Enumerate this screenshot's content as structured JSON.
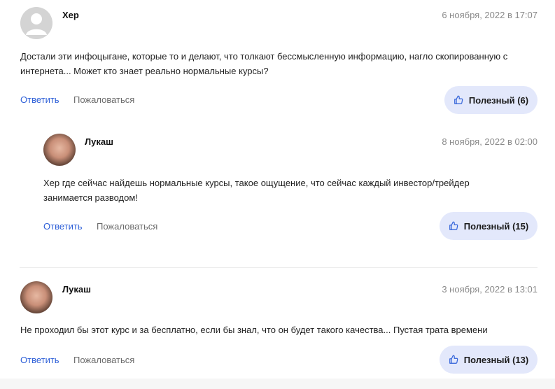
{
  "comments": [
    {
      "author": "Хер",
      "date": "6 ноября, 2022 в 17:07",
      "text": "Достали эти инфоцыгане, которые то и делают, что толкают бессмысленную информацию, нагло скопированную с интернета... Может кто знает реально нормальные курсы?",
      "reply_label": "Ответить",
      "report_label": "Пожаловаться",
      "useful_label": "Полезный (6)"
    },
    {
      "author": "Лукаш",
      "date": "8 ноября, 2022 в 02:00",
      "text": "Хер где сейчас найдешь нормальные курсы, такое ощущение, что сейчас каждый инвестор/трейдер занимается разводом!",
      "reply_label": "Ответить",
      "report_label": "Пожаловаться",
      "useful_label": "Полезный (15)"
    },
    {
      "author": "Лукаш",
      "date": "3 ноября, 2022 в 13:01",
      "text": "Не проходил бы этот курс и за бесплатно, если бы знал, что он будет такого качества... Пустая трата времени",
      "reply_label": "Ответить",
      "report_label": "Пожаловаться",
      "useful_label": "Полезный (13)"
    }
  ],
  "colors": {
    "accent": "#2d5fd8",
    "useful_bg": "#e3e8fb",
    "muted": "#8a8a8a"
  },
  "icons": {
    "useful": "thumbs-up-icon"
  }
}
